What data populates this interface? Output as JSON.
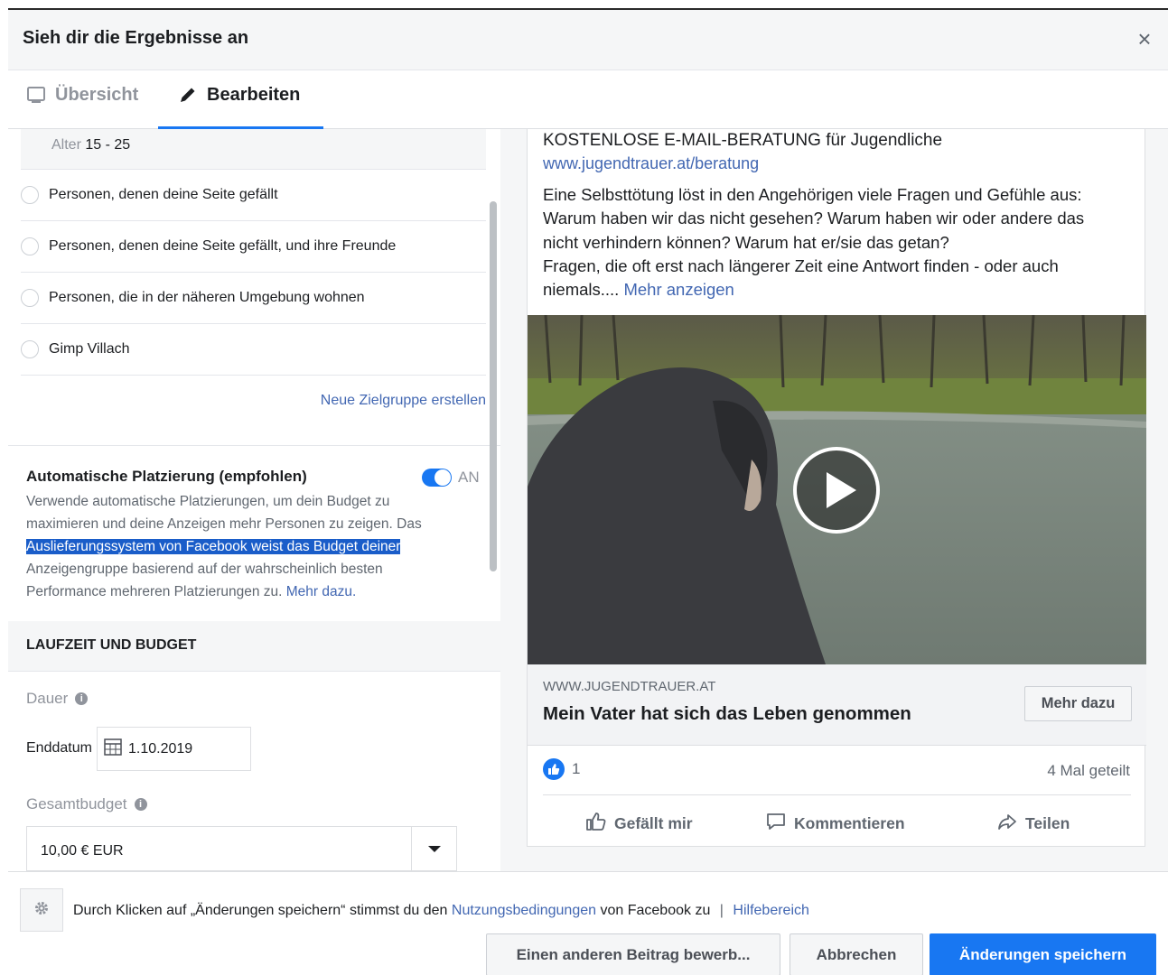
{
  "header": {
    "title": "Sieh dir die Ergebnisse an",
    "close_label": "×"
  },
  "tabs": [
    {
      "label": "Übersicht",
      "icon": "monitor-icon"
    },
    {
      "label": "Bearbeiten",
      "icon": "pencil-icon"
    }
  ],
  "audience": {
    "age_label": "Alter",
    "age_value": "15 - 25",
    "options": [
      "Personen, denen deine Seite gefällt",
      "Personen, denen deine Seite gefällt, und ihre Freunde",
      "Personen, die in der näheren Umgebung wohnen",
      "Gimp Villach"
    ],
    "new_audience_link": "Neue Zielgruppe erstellen"
  },
  "placement": {
    "title": "Automatische Platzierung (empfohlen)",
    "toggle_label": "AN",
    "desc_line1": "Verwende automatische Platzierungen, um dein Budget zu",
    "desc_line2": "maximieren und deine Anzeigen mehr Personen zu zeigen. Das",
    "desc_highlight": "Auslieferungssystem von Facebook weist das Budget deiner",
    "desc_line4": "Anzeigengruppe basierend auf der wahrscheinlich besten",
    "desc_line5": "Performance mehreren Platzierungen zu.",
    "learn_more": "Mehr dazu."
  },
  "schedule": {
    "section_title": "LAUFZEIT UND BUDGET",
    "duration_label": "Dauer",
    "end_date_label": "Enddatum",
    "end_date_value": "1.10.2019",
    "budget_label": "Gesamtbudget",
    "budget_value": "10,00 € EUR"
  },
  "ad": {
    "headline": "KOSTENLOSE E-MAIL-BERATUNG für Jugendliche",
    "url": "www.jugendtrauer.at/beratung",
    "body_lines": [
      "Eine Selbsttötung löst in den Angehörigen viele Fragen und Gefühle aus:",
      "Warum haben wir das nicht gesehen? Warum haben wir oder andere das",
      "nicht verhindern können? Warum hat er/sie das getan?",
      "Fragen, die oft erst nach längerer Zeit eine Antwort finden - oder auch"
    ],
    "body_last": "niemals....",
    "see_more": "Mehr anzeigen",
    "link_domain": "WWW.JUGENDTRAUER.AT",
    "link_title": "Mein Vater hat sich das Leben genommen",
    "cta_label": "Mehr dazu",
    "like_count": "1",
    "shares": "4 Mal geteilt",
    "actions": {
      "like": "Gefällt mir",
      "comment": "Kommentieren",
      "share": "Teilen"
    }
  },
  "footer": {
    "terms_before": "Durch Klicken auf „Änderungen speichern“ stimmst du den",
    "terms_link": "Nutzungsbedingungen",
    "terms_after": "von Facebook zu",
    "separator": "|",
    "help_link": "Hilfebereich",
    "btn_other": "Einen anderen Beitrag bewerb...",
    "btn_cancel": "Abbrechen",
    "btn_save": "Änderungen speichern"
  },
  "colors": {
    "accent": "#1877f2",
    "link": "#4267b2",
    "panel_bg": "#f5f6f7",
    "highlight": "#1a5dc9"
  }
}
